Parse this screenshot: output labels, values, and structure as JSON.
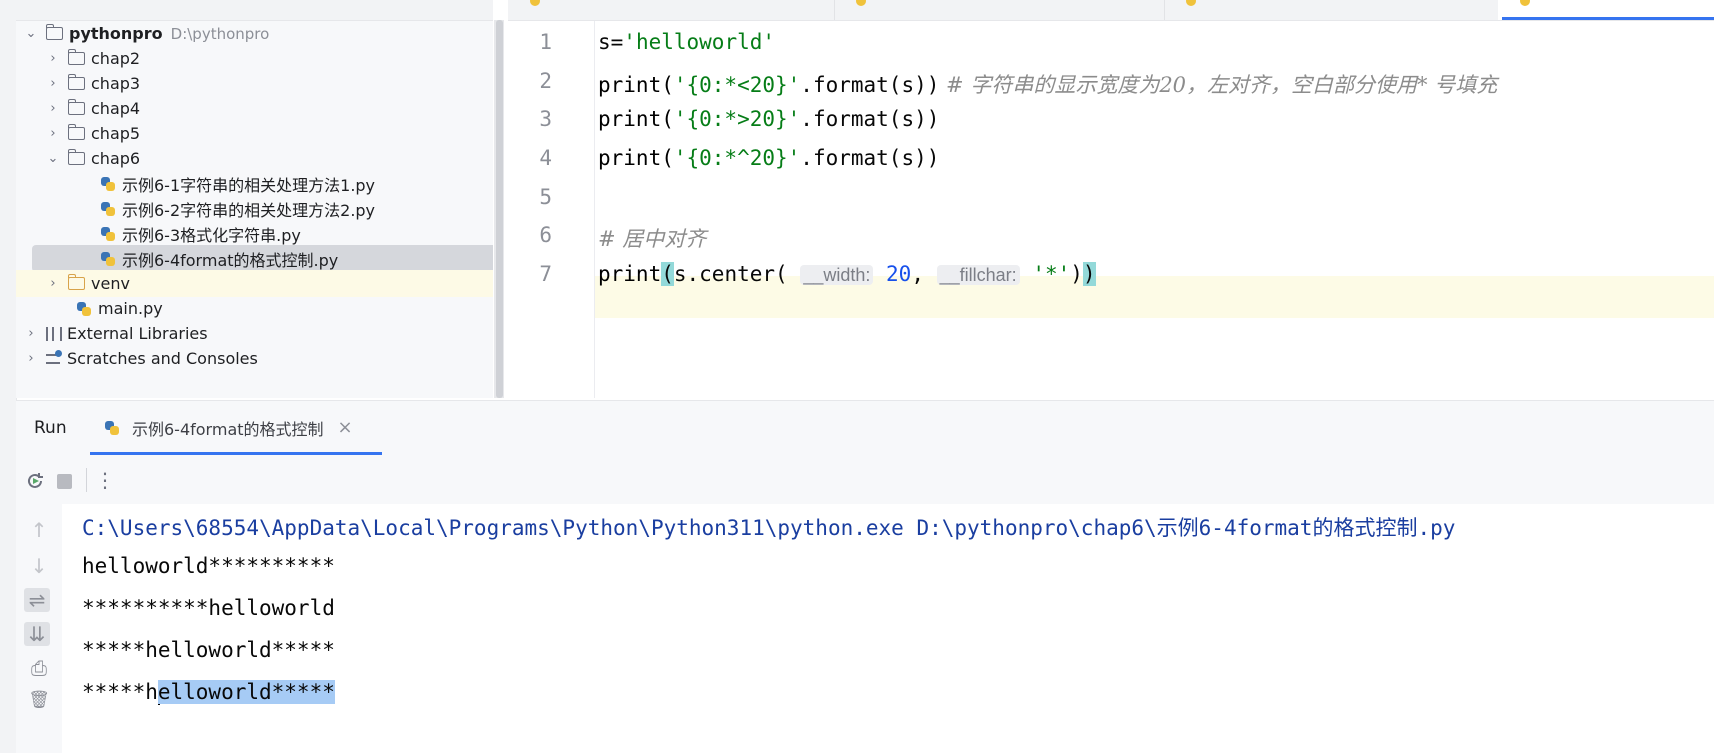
{
  "project": {
    "root": {
      "name": "pythonpro",
      "path": "D:\\pythonpro"
    },
    "folders": [
      "chap2",
      "chap3",
      "chap4",
      "chap5",
      "chap6"
    ],
    "chap6_files": [
      "示例6-1字符串的相关处理方法1.py",
      "示例6-2字符串的相关处理方法2.py",
      "示例6-3格式化字符串.py",
      "示例6-4format的格式控制.py"
    ],
    "venv": "venv",
    "main": "main.py",
    "external_libraries": "External Libraries",
    "scratches": "Scratches and Consoles"
  },
  "editor": {
    "line_numbers": [
      "1",
      "2",
      "3",
      "4",
      "5",
      "6",
      "7"
    ],
    "line1": {
      "var": "s=",
      "str": "'helloworld'"
    },
    "line2": {
      "fn": "print(",
      "str": "'{0:*<20}'",
      "rest": ".format(s))",
      "comment": " # 字符串的显示宽度为20，左对齐，空白部分使用* 号填充"
    },
    "line3": {
      "fn": "print(",
      "str": "'{0:*>20}'",
      "rest": ".format(s))"
    },
    "line4": {
      "fn": "print(",
      "str": "'{0:*^20}'",
      "rest": ".format(s))"
    },
    "line6": {
      "comment": "# 居中对齐"
    },
    "line7": {
      "fn": "print",
      "open_paren": "(",
      "call": "s.center( ",
      "hint_width": "__width:",
      "width_val": "20",
      "comma": ", ",
      "hint_fill": "__fillchar:",
      "fill_val": "'*'",
      "close_inner": ")",
      "close_paren": ")"
    }
  },
  "run": {
    "title": "Run",
    "tab_label": "示例6-4format的格式控制",
    "tab_close": "×",
    "command": "C:\\Users\\68554\\AppData\\Local\\Programs\\Python\\Python311\\python.exe D:\\pythonpro\\chap6\\示例6-4format的格式控制.py",
    "output": [
      "helloworld**********",
      "**********helloworld",
      "*****helloworld*****"
    ],
    "last_line": {
      "before": "*****h",
      "selected": "elloworld*****"
    },
    "toolbar_more": "⋮"
  },
  "icons": {
    "rerun": "rerun-icon",
    "stop": "stop-icon",
    "up": "↑",
    "down": "↓",
    "wrap": "⇌",
    "scroll_end": "⇊",
    "print": "⎙",
    "trash": "🗑"
  },
  "colors": {
    "accent": "#3574f0",
    "string": "#067d17",
    "number": "#1750eb",
    "comment": "#8c8c8c",
    "selection": "#a6cbf5"
  }
}
